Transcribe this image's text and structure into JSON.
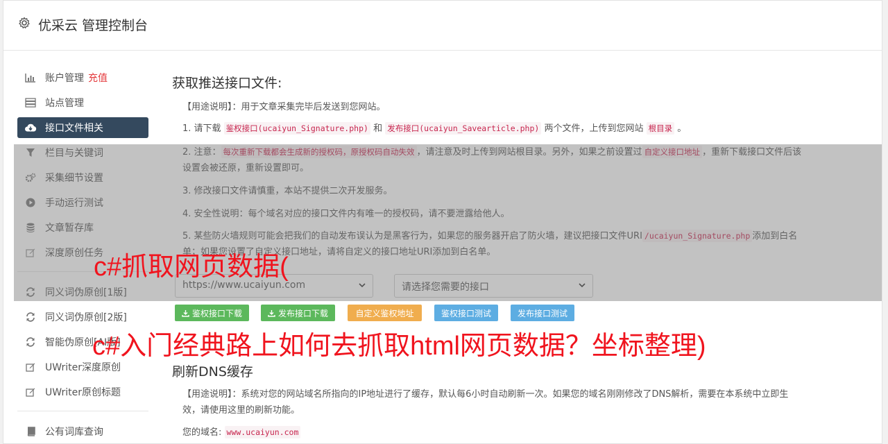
{
  "header": {
    "title": "优采云 管理控制台",
    "icon": "gear-icon"
  },
  "sidebar": {
    "items": [
      {
        "label": "账户管理",
        "extra": "充值",
        "icon": "bar-chart-icon"
      },
      {
        "label": "站点管理",
        "icon": "server-icon"
      },
      {
        "label": "接口文件相关",
        "icon": "cloud-download-icon",
        "active": true
      },
      {
        "label": "栏目与关键词",
        "icon": "filter-icon"
      },
      {
        "label": "采集细节设置",
        "icon": "cogs-icon"
      },
      {
        "label": "手动运行测试",
        "icon": "play-circle-icon"
      },
      {
        "label": "文章暂存库",
        "icon": "database-icon"
      },
      {
        "label": "深度原创任务",
        "icon": "edit-icon"
      },
      {
        "label": "同义词伪原创[1版]",
        "icon": "refresh-icon"
      },
      {
        "label": "同义词伪原创[2版]",
        "icon": "refresh-icon"
      },
      {
        "label": "智能伪原创[AI版]",
        "icon": "refresh-icon"
      },
      {
        "label": "UWriter深度原创",
        "icon": "edit-icon"
      },
      {
        "label": "UWriter原创标题",
        "icon": "edit-icon"
      },
      {
        "label": "公有词库查询",
        "icon": "book-icon"
      }
    ]
  },
  "main": {
    "section1": {
      "title": "获取推送接口文件:",
      "usage": "【用途说明】：用于文章采集完毕后发送到您网站。",
      "item1": {
        "a": "1. 请下载",
        "c1": "鉴权接口(ucaiyun_Signature.php)",
        "b": "和",
        "c2": "发布接口(ucaiyun_Savearticle.php)",
        "d": "两个文件，上传到您网站",
        "c3": "根目录",
        "e": "。"
      },
      "item2": {
        "a": "2. 注意：",
        "c1": "每次重新下载都会生成新的授权码，原授权码自动失效",
        "b": "，请注意及时上传到网站根目录。另外，如果之前设置过",
        "c2": "自定义接口地址",
        "d": "，重新下载接口文件后该设置会被还原，重新设置即可。"
      },
      "item3": "3. 修改接口文件请慎重，本站不提供二次开发服务。",
      "item4": "4. 安全性说明：每个域名对应的接口文件内有唯一的授权码，请不要泄露给他人。",
      "item5": {
        "a": "5. 某些防火墙规则可能会把我们的自动发布误认为是黑客行为，如果您的服务器开启了防火墙，建议把接口文件URI",
        "c1": "/ucaiyun_Signature.php",
        "b": "添加到白名单；如果您设置了自定义接口地址，请将自定义的接口地址URI添加到白名单。"
      },
      "site_select": "https://www.ucaiyun.com",
      "api_select": "请选择您需要的接口",
      "buttons": {
        "dl_sign": "鉴权接口下载",
        "dl_publish": "发布接口下载",
        "custom_sign": "自定义鉴权地址",
        "test_sign": "鉴权接口测试",
        "test_publish": "发布接口测试"
      }
    },
    "section2": {
      "title": "刷新DNS缓存",
      "usage": "【用途说明】：系统对您的网站域名所指向的IP地址进行了缓存，默认每6小时自动刷新一次。如果您的域名刚刚修改了DNS解析，需要在本系统中立即生效，请使用这里的刷新功能。",
      "domain_label": "您的域名:",
      "domain_value": "www.ucaiyun.com"
    }
  },
  "watermark": {
    "line1": "c#抓取网页数据(",
    "line2": "c#入门经典路上如何去抓取html网页数据？坐标整理)"
  }
}
